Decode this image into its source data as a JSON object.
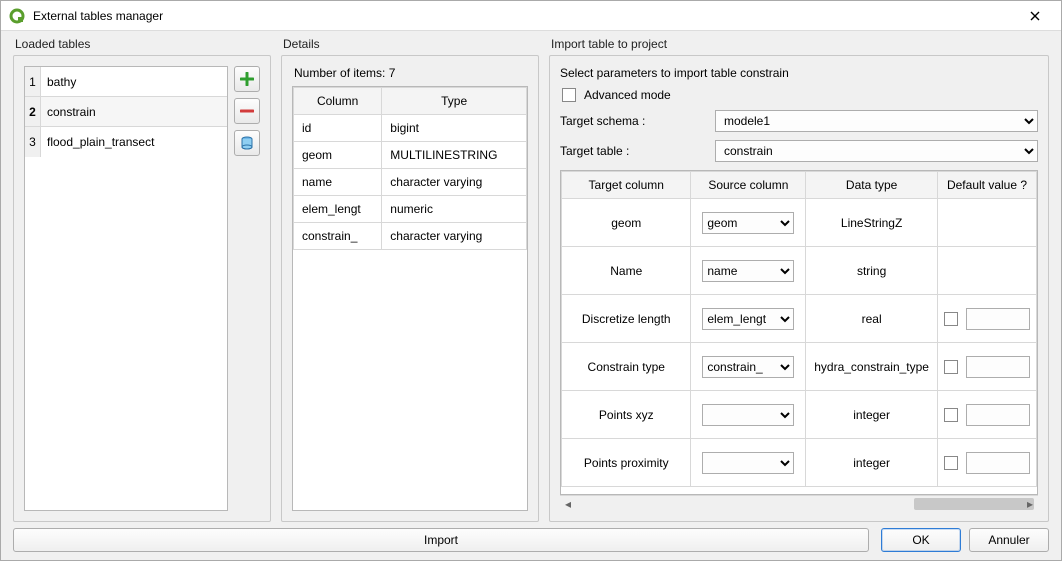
{
  "window": {
    "title": "External tables manager"
  },
  "panels": {
    "loaded_title": "Loaded tables",
    "details_title": "Details",
    "import_title": "Import table to project"
  },
  "loaded": {
    "items": [
      {
        "idx": "1",
        "name": "bathy"
      },
      {
        "idx": "2",
        "name": "constrain"
      },
      {
        "idx": "3",
        "name": "flood_plain_transect"
      }
    ],
    "selected_index": 1
  },
  "details": {
    "count_label": "Number of items: 7",
    "headers": {
      "col": "Column",
      "type": "Type"
    },
    "rows": [
      {
        "col": "id",
        "type": "bigint"
      },
      {
        "col": "geom",
        "type": "MULTILINESTRING"
      },
      {
        "col": "name",
        "type": "character varying"
      },
      {
        "col": "elem_lengt",
        "type": "numeric"
      },
      {
        "col": "constrain_",
        "type": "character varying"
      }
    ]
  },
  "import": {
    "intro": "Select parameters to import table constrain",
    "advanced_label": "Advanced mode",
    "schema_label": "Target schema :",
    "schema_value": "modele1",
    "table_label": "Target table :",
    "table_value": "constrain",
    "map_headers": {
      "target": "Target column",
      "source": "Source column",
      "dtype": "Data type",
      "default": "Default value ?"
    },
    "map_rows": [
      {
        "target": "geom",
        "source": "geom",
        "dtype": "LineStringZ",
        "has_default": false
      },
      {
        "target": "Name",
        "source": "name",
        "dtype": "string",
        "has_default": false
      },
      {
        "target": "Discretize length",
        "source": "elem_lengt",
        "dtype": "real",
        "has_default": true
      },
      {
        "target": "Constrain type",
        "source": "constrain_",
        "dtype": "hydra_constrain_type",
        "has_default": true
      },
      {
        "target": "Points xyz",
        "source": "",
        "dtype": "integer",
        "has_default": true
      },
      {
        "target": "Points proximity",
        "source": "",
        "dtype": "integer",
        "has_default": true
      }
    ]
  },
  "buttons": {
    "import": "Import",
    "ok": "OK",
    "cancel": "Annuler"
  },
  "icons": {
    "plus": "plus-icon",
    "minus": "minus-icon",
    "db": "database-icon",
    "app": "qgis-icon",
    "close": "close-icon"
  }
}
